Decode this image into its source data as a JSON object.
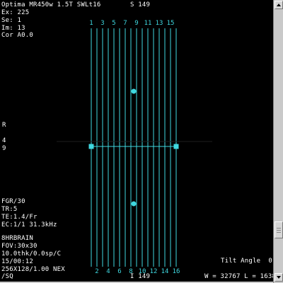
{
  "viewer": {
    "header": {
      "scanner": "Optima MR450w 1.5T SWLt16",
      "slice": "S 149",
      "exam": "Ex: 225",
      "series": "Se: 1",
      "image": "Im: 13",
      "coronal": "Cor A0.0"
    },
    "orientation": {
      "left_top": "R",
      "left_mid": "4",
      "left_bot": "9",
      "bottom": "I 149"
    },
    "sequence": {
      "type": "FGR/30",
      "tr": "TR:5",
      "te": "TE:1.4/Fr",
      "ec": "EC:1/1 31.3kHz"
    },
    "protocol": {
      "name": "8HRBRAIN",
      "fov": "FOV:30x30",
      "thickness": "10.0thk/0.0sp/C",
      "time": "15/00:12",
      "matrix": "256X128/1.00 NEX",
      "mode": "/SQ"
    },
    "tilt": "Tilt Angle  0",
    "window_level": "W = 32767 L = 1638"
  },
  "slices": {
    "top_labels": [
      "1",
      "3",
      "5",
      "7",
      "9",
      "11",
      "13",
      "15"
    ],
    "bottom_labels": [
      "2",
      "4",
      "6",
      "8",
      "10",
      "12",
      "14",
      "16"
    ],
    "count": 16
  },
  "colors": {
    "slice_line": "#3fd8e0",
    "background": "#000000",
    "text": "#ffffff"
  },
  "scrollbar": {
    "up_icon": "arrow-up-icon",
    "down_icon": "arrow-down-icon"
  }
}
